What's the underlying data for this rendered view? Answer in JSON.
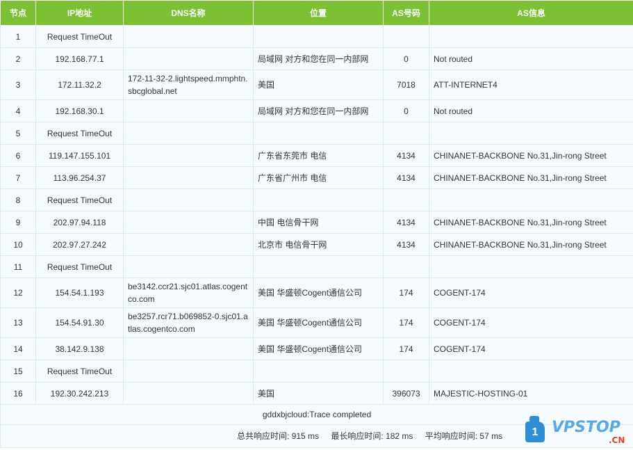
{
  "headers": {
    "node": "节点",
    "ip": "IP地址",
    "dns": "DNS名称",
    "location": "位置",
    "as_num": "AS号码",
    "as_info": "AS信息"
  },
  "rows": [
    {
      "node": "1",
      "ip": "Request TimeOut",
      "dns": "",
      "location": "",
      "as_num": "",
      "as_info": ""
    },
    {
      "node": "2",
      "ip": "192.168.77.1",
      "dns": "",
      "location": "局域网 对方和您在同一内部网",
      "as_num": "0",
      "as_info": "Not routed"
    },
    {
      "node": "3",
      "ip": "172.11.32.2",
      "dns": "172-11-32-2.lightspeed.mmphtn.sbcglobal.net",
      "location": "美国",
      "as_num": "7018",
      "as_info": "ATT-INTERNET4"
    },
    {
      "node": "4",
      "ip": "192.168.30.1",
      "dns": "",
      "location": "局域网 对方和您在同一内部网",
      "as_num": "0",
      "as_info": "Not routed"
    },
    {
      "node": "5",
      "ip": "Request TimeOut",
      "dns": "",
      "location": "",
      "as_num": "",
      "as_info": ""
    },
    {
      "node": "6",
      "ip": "119.147.155.101",
      "dns": "",
      "location": "广东省东莞市 电信",
      "as_num": "4134",
      "as_info": "CHINANET-BACKBONE No.31,Jin-rong Street"
    },
    {
      "node": "7",
      "ip": "113.96.254.37",
      "dns": "",
      "location": "广东省广州市 电信",
      "as_num": "4134",
      "as_info": "CHINANET-BACKBONE No.31,Jin-rong Street"
    },
    {
      "node": "8",
      "ip": "Request TimeOut",
      "dns": "",
      "location": "",
      "as_num": "",
      "as_info": ""
    },
    {
      "node": "9",
      "ip": "202.97.94.118",
      "dns": "",
      "location": "中国 电信骨干网",
      "as_num": "4134",
      "as_info": "CHINANET-BACKBONE No.31,Jin-rong Street"
    },
    {
      "node": "10",
      "ip": "202.97.27.242",
      "dns": "",
      "location": "北京市 电信骨干网",
      "as_num": "4134",
      "as_info": "CHINANET-BACKBONE No.31,Jin-rong Street"
    },
    {
      "node": "11",
      "ip": "Request TimeOut",
      "dns": "",
      "location": "",
      "as_num": "",
      "as_info": ""
    },
    {
      "node": "12",
      "ip": "154.54.1.193",
      "dns": "be3142.ccr21.sjc01.atlas.cogentco.com",
      "location": "美国 华盛顿Cogent通信公司",
      "as_num": "174",
      "as_info": "COGENT-174"
    },
    {
      "node": "13",
      "ip": "154.54.91.30",
      "dns": "be3257.rcr71.b069852-0.sjc01.atlas.cogentco.com",
      "location": "美国 华盛顿Cogent通信公司",
      "as_num": "174",
      "as_info": "COGENT-174"
    },
    {
      "node": "14",
      "ip": "38.142.9.138",
      "dns": "",
      "location": "美国 华盛顿Cogent通信公司",
      "as_num": "174",
      "as_info": "COGENT-174"
    },
    {
      "node": "15",
      "ip": "Request TimeOut",
      "dns": "",
      "location": "",
      "as_num": "",
      "as_info": ""
    },
    {
      "node": "16",
      "ip": "192.30.242.213",
      "dns": "",
      "location": "美国",
      "as_num": "396073",
      "as_info": "MAJESTIC-HOSTING-01"
    }
  ],
  "summary": "gddxbjcloud:Trace completed",
  "stats": {
    "total": "总共响应时间: 915 ms",
    "max": "最长响应时间: 182 ms",
    "avg": "平均响应时间: 57 ms"
  },
  "logo": {
    "badge": "1",
    "brand": "VPSTOP",
    "tld": ".CN"
  },
  "colors": {
    "header_bg": "#7cc134",
    "row_bg": "#f6fbfe",
    "border": "#dde9f3"
  }
}
